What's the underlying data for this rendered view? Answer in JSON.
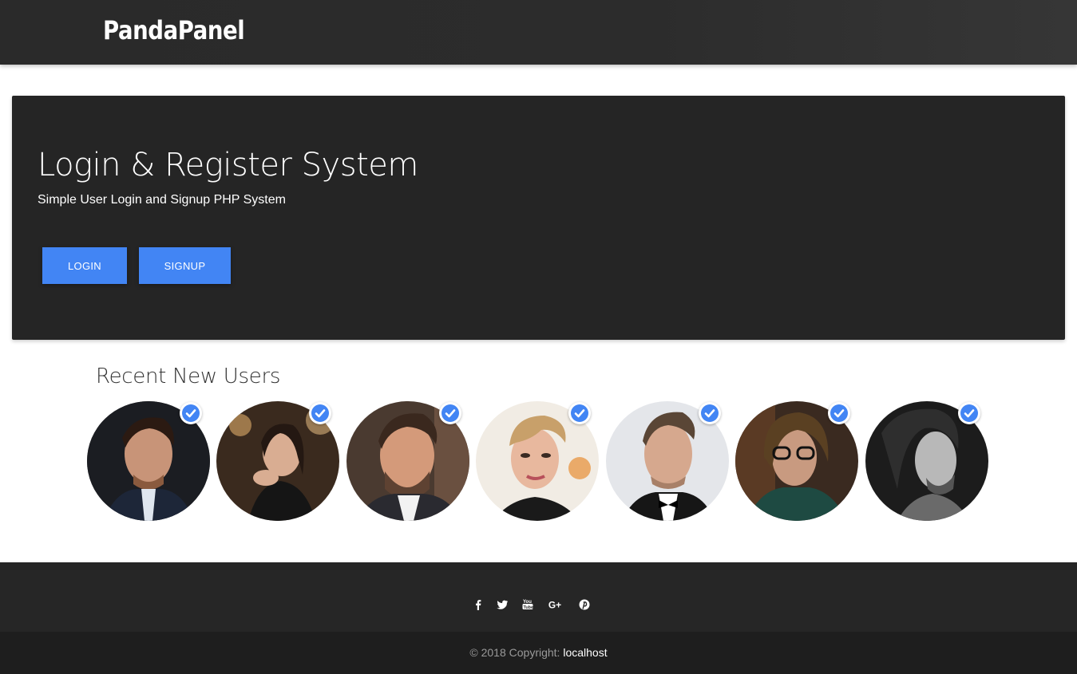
{
  "navbar": {
    "brand": "PandaPanel"
  },
  "hero": {
    "title": "Login & Register System",
    "subtitle": "Simple User Login and Signup PHP System",
    "login_label": "LOGIN",
    "signup_label": "SIGNUP",
    "button_color": "#4285f4"
  },
  "recent_users": {
    "title": "Recent New Users",
    "avatars": [
      {
        "name": "user-avatar-1",
        "verified": true
      },
      {
        "name": "user-avatar-2",
        "verified": true
      },
      {
        "name": "user-avatar-3",
        "verified": true
      },
      {
        "name": "user-avatar-4",
        "verified": true
      },
      {
        "name": "user-avatar-5",
        "verified": true
      },
      {
        "name": "user-avatar-6",
        "verified": true
      },
      {
        "name": "user-avatar-7",
        "verified": true
      }
    ],
    "verified_badge_color": "#4285f4"
  },
  "footer": {
    "social_icons": [
      "facebook-icon",
      "twitter-icon",
      "youtube-icon",
      "google-plus-icon",
      "pinterest-icon"
    ],
    "copyright_prefix": "© 2018 Copyright: ",
    "copyright_link": "localhost"
  }
}
